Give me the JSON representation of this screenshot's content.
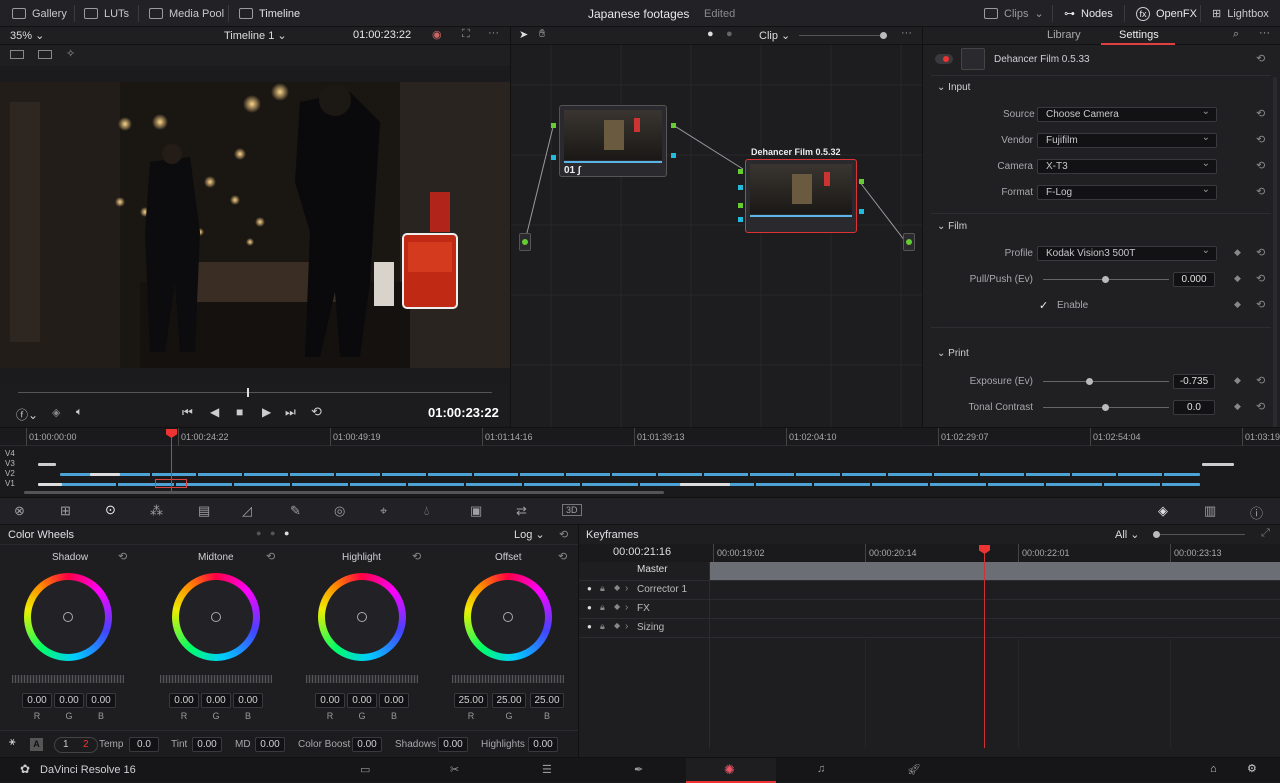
{
  "topbar": {
    "gallery": "Gallery",
    "luts": "LUTs",
    "media_pool": "Media Pool",
    "timeline": "Timeline",
    "project_title": "Japanese footages",
    "project_status": "Edited",
    "clips": "Clips",
    "nodes": "Nodes",
    "openfx": "OpenFX",
    "lightbox": "Lightbox"
  },
  "viewer": {
    "zoom": "35%",
    "timeline_name": "Timeline 1",
    "timecode_top": "01:00:23:22",
    "timecode_bottom": "01:00:23:22"
  },
  "node_editor": {
    "mode": "Clip",
    "node1_label": "01",
    "node2_title": "Dehancer Film 0.5.32"
  },
  "settings_panel": {
    "tab_library": "Library",
    "tab_settings": "Settings",
    "plugin_title": "Dehancer Film 0.5.33",
    "input_section": "Input",
    "source_label": "Source",
    "source_value": "Choose Camera",
    "vendor_label": "Vendor",
    "vendor_value": "Fujifilm",
    "camera_label": "Camera",
    "camera_value": "X-T3",
    "format_label": "Format",
    "format_value": "F-Log",
    "film_section": "Film",
    "profile_label": "Profile",
    "profile_value": "Kodak Vision3 500T",
    "pullpush_label": "Pull/Push (Ev)",
    "pullpush_value": "0.000",
    "enable_label": "Enable",
    "print_section": "Print",
    "exposure_label": "Exposure (Ev)",
    "exposure_value": "-0.735",
    "tonal_label": "Tonal Contrast",
    "tonal_value": "0.0"
  },
  "timeline": {
    "tracks": [
      "V4",
      "V3",
      "V2",
      "V1"
    ],
    "ruler": [
      "01:00:00:00",
      "01:00:24:22",
      "01:00:49:19",
      "01:01:14:16",
      "01:01:39:13",
      "01:02:04:10",
      "01:02:29:07",
      "01:02:54:04",
      "01:03:19"
    ]
  },
  "color_wheels": {
    "title": "Color Wheels",
    "mode": "Log",
    "wheels": [
      {
        "name": "Shadow",
        "r": "0.00",
        "g": "0.00",
        "b": "0.00"
      },
      {
        "name": "Midtone",
        "r": "0.00",
        "g": "0.00",
        "b": "0.00"
      },
      {
        "name": "Highlight",
        "r": "0.00",
        "g": "0.00",
        "b": "0.00"
      },
      {
        "name": "Offset",
        "r": "25.00",
        "g": "25.00",
        "b": "25.00"
      }
    ],
    "rgb_labels": {
      "r": "R",
      "g": "G",
      "b": "B"
    }
  },
  "adjust_bar": {
    "auto": "A",
    "page1": "1",
    "page2": "2",
    "temp_label": "Temp",
    "temp_value": "0.0",
    "tint_label": "Tint",
    "tint_value": "0.00",
    "md_label": "MD",
    "md_value": "0.00",
    "boost_label": "Color Boost",
    "boost_value": "0.00",
    "shadows_label": "Shadows",
    "shadows_value": "0.00",
    "highlights_label": "Highlights",
    "highlights_value": "0.00"
  },
  "keyframes": {
    "title": "Keyframes",
    "filter": "All",
    "current_tc": "00:00:21:16",
    "ruler": [
      "00:00:19:02",
      "00:00:20:14",
      "00:00:22:01",
      "00:00:23:13"
    ],
    "master": "Master",
    "rows": [
      "Corrector 1",
      "FX",
      "Sizing"
    ]
  },
  "status": {
    "app_name": "DaVinci Resolve 16"
  }
}
